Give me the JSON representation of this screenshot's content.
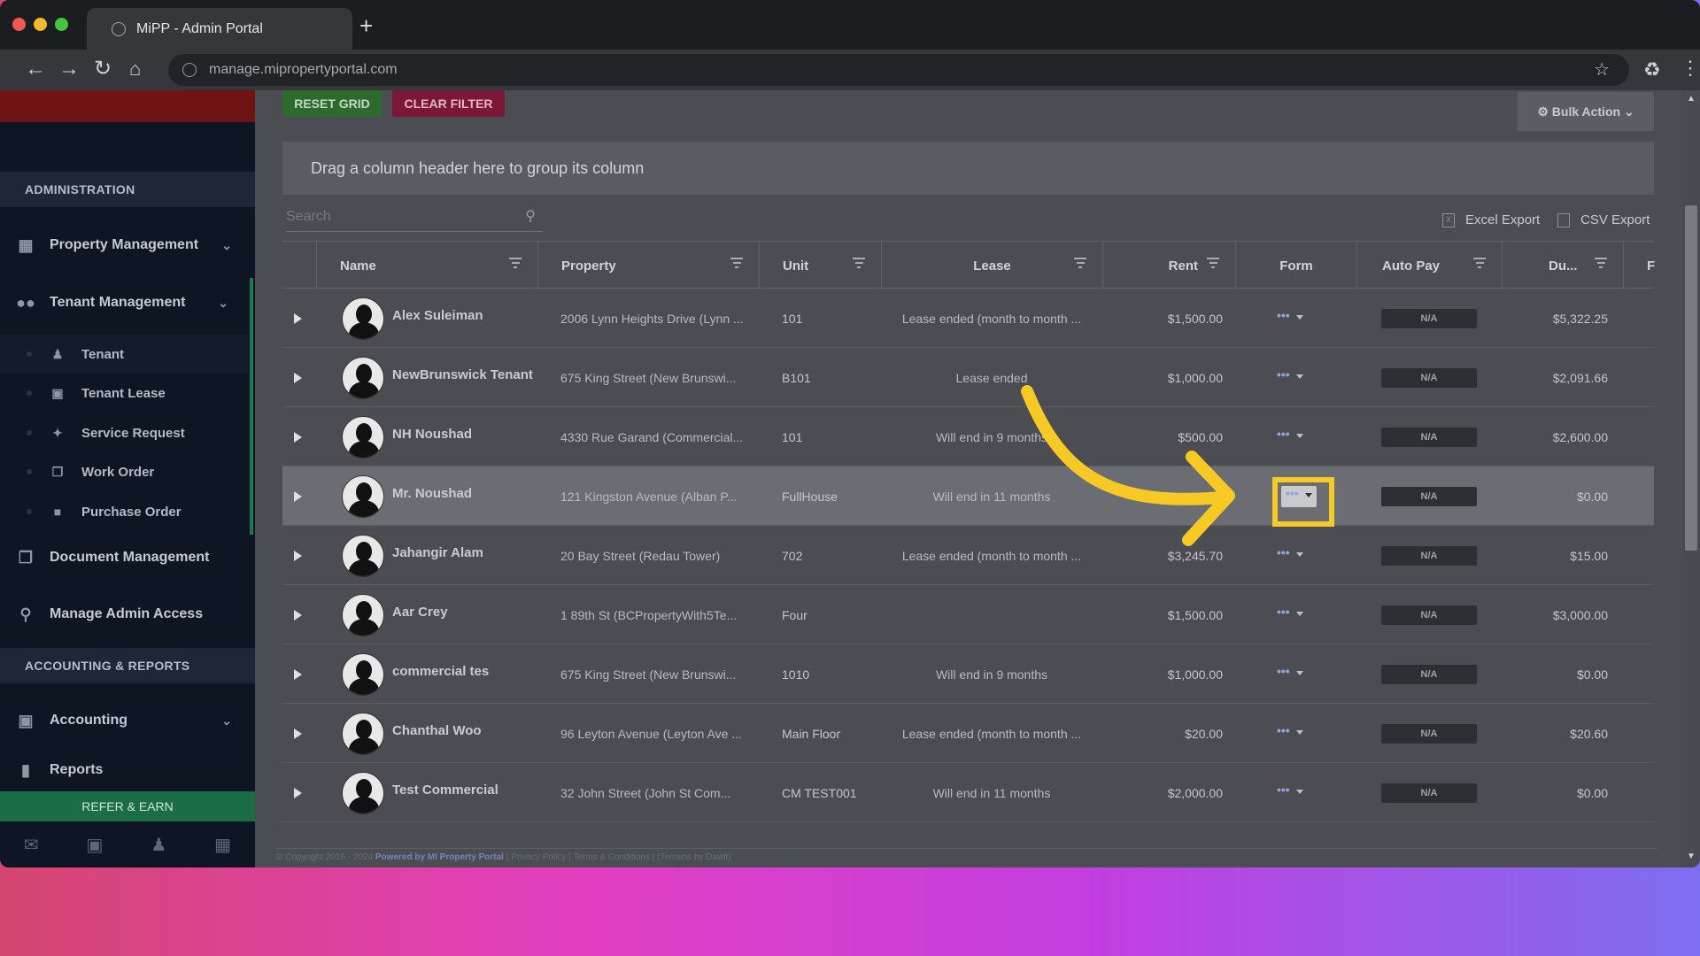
{
  "browser": {
    "tab_title": "MiPP - Admin Portal",
    "new_tab": "+",
    "url": "manage.mipropertyportal.com"
  },
  "sidebar": {
    "sections": [
      {
        "label": "ADMINISTRATION"
      },
      {
        "label": "ACCOUNTING & REPORTS"
      }
    ],
    "items": [
      {
        "label": "Property Management",
        "icon": "building-icon"
      },
      {
        "label": "Tenant Management",
        "icon": "users-icon"
      },
      {
        "label": "Document Management",
        "icon": "documents-icon"
      },
      {
        "label": "Manage Admin Access",
        "icon": "key-icon"
      },
      {
        "label": "Accounting",
        "icon": "money-icon"
      },
      {
        "label": "Reports",
        "icon": "bar-chart-icon"
      }
    ],
    "sub_items": [
      {
        "label": "Tenant",
        "icon": "user-icon"
      },
      {
        "label": "Tenant Lease",
        "icon": "calendar-icon"
      },
      {
        "label": "Service Request",
        "icon": "wrench-icon"
      },
      {
        "label": "Work Order",
        "icon": "copy-icon"
      },
      {
        "label": "Purchase Order",
        "icon": "truck-icon"
      }
    ],
    "refer": "REFER & EARN"
  },
  "toolbar": {
    "reset_grid": "RESET GRID",
    "clear_filter": "CLEAR FILTER",
    "bulk_action": "Bulk Action"
  },
  "grid": {
    "group_hint": "Drag a column header here to group its column",
    "search_placeholder": "Search",
    "excel_export": "Excel Export",
    "csv_export": "CSV Export",
    "columns": [
      "Name",
      "Property",
      "Unit",
      "Lease",
      "Rent",
      "Form",
      "Auto Pay",
      "Du...",
      "F"
    ],
    "rows": [
      {
        "name": "Alex Suleiman",
        "property": "2006 Lynn Heights Drive (Lynn ...",
        "unit": "101",
        "lease": "Lease ended (month to month ...",
        "rent": "$1,500.00",
        "autopay": "N/A",
        "due": "$5,322.25"
      },
      {
        "name": "NewBrunswick Tenant",
        "property": "675 King Street (New Brunswi...",
        "unit": "B101",
        "lease": "Lease ended",
        "rent": "$1,000.00",
        "autopay": "N/A",
        "due": "$2,091.66"
      },
      {
        "name": "NH Noushad",
        "property": "4330 Rue Garand (Commercial...",
        "unit": "101",
        "lease": "Will end in 9 months",
        "rent": "$500.00",
        "autopay": "N/A",
        "due": "$2,600.00"
      },
      {
        "name": "Mr. Noushad",
        "property": "121 Kingston Avenue (Alban P...",
        "unit": "FullHouse",
        "lease": "Will end in 11 months",
        "rent": "",
        "autopay": "N/A",
        "due": "$0.00"
      },
      {
        "name": "Jahangir Alam",
        "property": "20 Bay Street (Redau Tower)",
        "unit": "702",
        "lease": "Lease ended (month to month ...",
        "rent": "$3,245.70",
        "autopay": "N/A",
        "due": "$15.00"
      },
      {
        "name": "Aar Crey",
        "property": "1 89th St (BCPropertyWith5Te...",
        "unit": "Four",
        "lease": "",
        "rent": "$1,500.00",
        "autopay": "N/A",
        "due": "$3,000.00"
      },
      {
        "name": "commercial tes",
        "property": "675 King Street (New Brunswi...",
        "unit": "1010",
        "lease": "Will end in 9 months",
        "rent": "$1,000.00",
        "autopay": "N/A",
        "due": "$0.00"
      },
      {
        "name": "Chanthal Woo",
        "property": "96 Leyton Avenue (Leyton Ave ...",
        "unit": "Main Floor",
        "lease": "Lease ended (month to month ...",
        "rent": "$20.00",
        "autopay": "N/A",
        "due": "$20.60"
      },
      {
        "name": "Test Commercial",
        "property": "32 John Street (John St Com...",
        "unit": "CM TEST001",
        "lease": "Will end in 11 months",
        "rent": "$2,000.00",
        "autopay": "N/A",
        "due": "$0.00"
      }
    ],
    "highlighted_row": 3
  },
  "footer": {
    "copyright": "© Copyright 2016 - 2024 ",
    "powered": "Powered by MI Property Portal",
    "links": " | Privacy Policy | Terms & Conditions | (Terrains by Dawit)"
  },
  "annotation": {
    "color": "#f7c924"
  }
}
